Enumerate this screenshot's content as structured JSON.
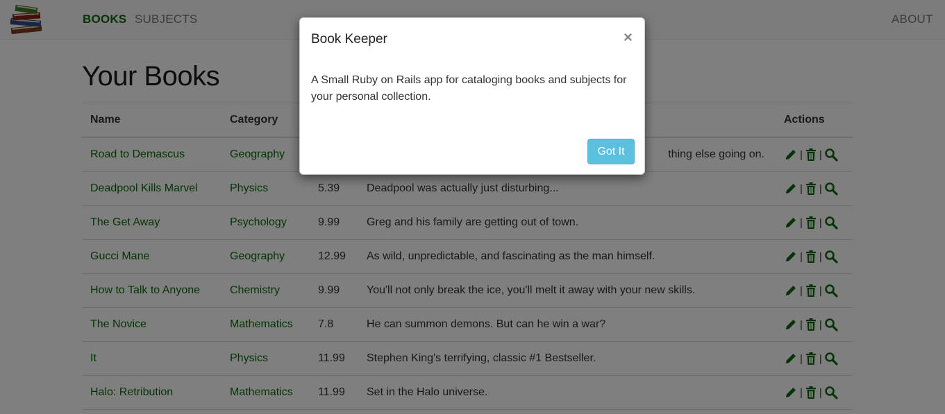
{
  "nav": {
    "books": "BOOKS",
    "subjects": "SUBJECTS",
    "about": "ABOUT"
  },
  "page": {
    "title": "Your Books"
  },
  "table": {
    "headers": {
      "name": "Name",
      "category": "Category",
      "actions": "Actions"
    },
    "rows": [
      {
        "name": "Road to Demascus",
        "category": "Geography",
        "price": "",
        "description": "thing else going on."
      },
      {
        "name": "Deadpool Kills Marvel",
        "category": "Physics",
        "price": "5.39",
        "description": "Deadpool was actually just disturbing..."
      },
      {
        "name": "The Get Away",
        "category": "Psychology",
        "price": "9.99",
        "description": "Greg and his family are getting out of town."
      },
      {
        "name": "Gucci Mane",
        "category": "Geography",
        "price": "12.99",
        "description": "As wild, unpredictable, and fascinating as the man himself."
      },
      {
        "name": "How to Talk to Anyone",
        "category": "Chemistry",
        "price": "9.99",
        "description": "You'll not only break the ice, you'll melt it away with your new skills."
      },
      {
        "name": "The Novice",
        "category": "Mathematics",
        "price": "7.8",
        "description": "He can summon demons. But can he win a war?"
      },
      {
        "name": "It",
        "category": "Physics",
        "price": "11.99",
        "description": "Stephen King's terrifying, classic #1 Bestseller."
      },
      {
        "name": "Halo: Retribution",
        "category": "Mathematics",
        "price": "11.99",
        "description": "Set in the Halo universe."
      }
    ],
    "action_icons": [
      "pencil-icon",
      "trash-icon",
      "search-icon"
    ],
    "separator": "|"
  },
  "modal": {
    "title": "Book Keeper",
    "close": "×",
    "body": "A Small Ruby on Rails app for cataloging books and subjects for your personal collection.",
    "button": "Got It"
  },
  "colors": {
    "link_green": "#0b6b0b",
    "button_info": "#5bc0de",
    "navbar_bg": "#f8f8f8"
  }
}
